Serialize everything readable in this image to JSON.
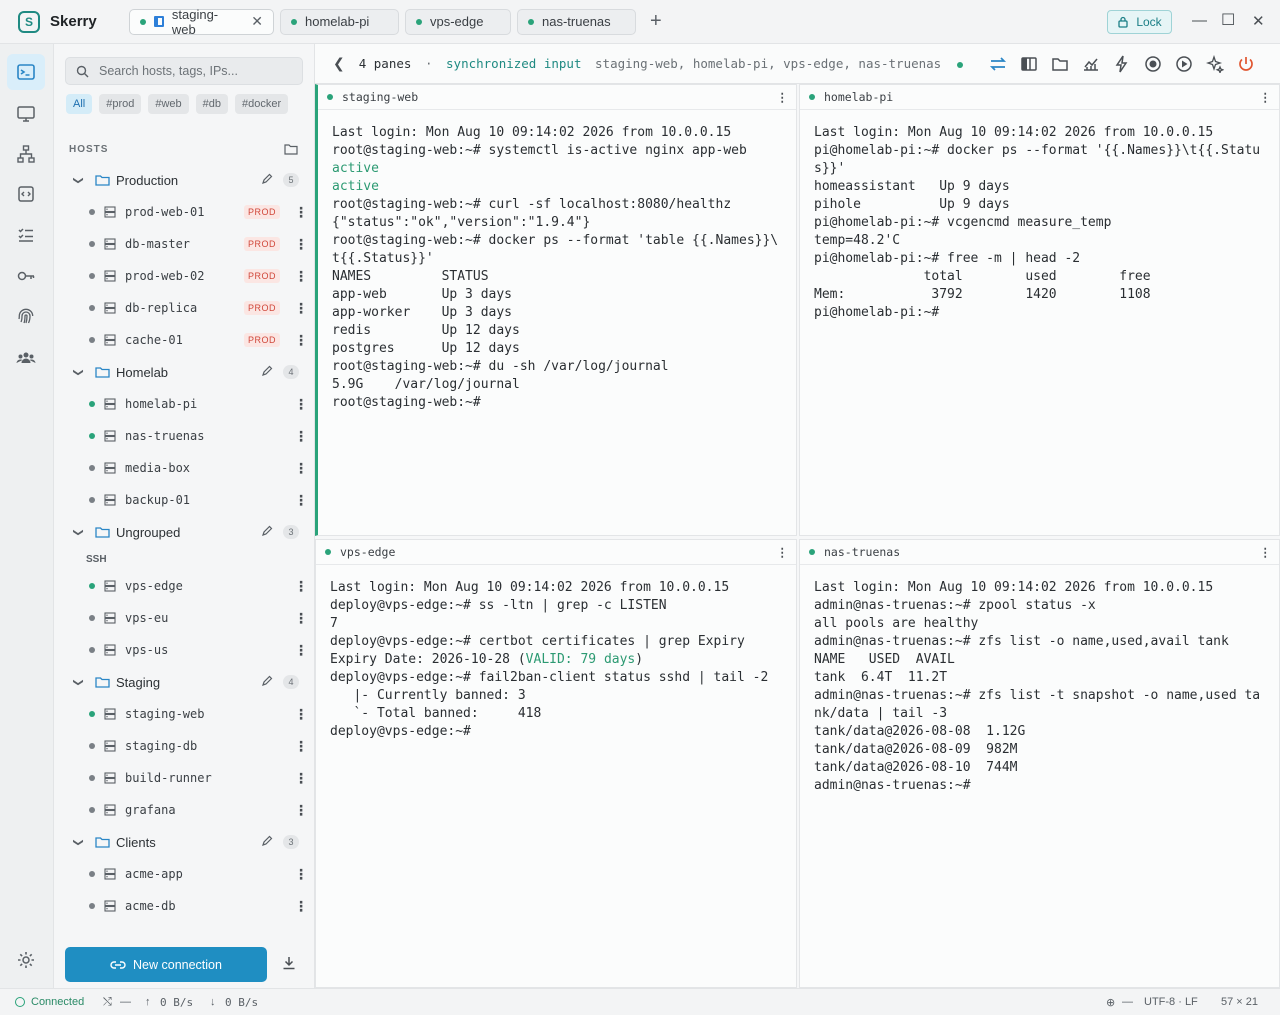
{
  "app": {
    "name": "Skerry"
  },
  "tabs": [
    {
      "label": "staging-web",
      "active": true
    },
    {
      "label": "homelab-pi",
      "active": false
    },
    {
      "label": "vps-edge",
      "active": false
    },
    {
      "label": "nas-truenas",
      "active": false
    }
  ],
  "titlebar": {
    "lock_label": "Lock",
    "minimize": "—",
    "maximize": "☐",
    "close": "✕",
    "add_tab": "+"
  },
  "sidebar": {
    "search_placeholder": "Search hosts, tags, IPs...",
    "tags": [
      "All",
      "#prod",
      "#web",
      "#db",
      "#docker"
    ],
    "hosts_label": "HOSTS",
    "groups": [
      {
        "name": "Production",
        "count": "5",
        "hosts": [
          {
            "name": "prod-web-01",
            "badge": "PROD",
            "online": false
          },
          {
            "name": "db-master",
            "badge": "PROD",
            "online": false
          },
          {
            "name": "prod-web-02",
            "badge": "PROD",
            "online": false
          },
          {
            "name": "db-replica",
            "badge": "PROD",
            "online": false
          },
          {
            "name": "cache-01",
            "badge": "PROD",
            "online": false
          }
        ]
      },
      {
        "name": "Homelab",
        "count": "4",
        "hosts": [
          {
            "name": "homelab-pi",
            "online": true
          },
          {
            "name": "nas-truenas",
            "online": true
          },
          {
            "name": "media-box",
            "online": false
          },
          {
            "name": "backup-01",
            "online": false
          }
        ]
      },
      {
        "name": "Ungrouped",
        "count": "3",
        "subhead": "SSH",
        "hosts": [
          {
            "name": "vps-edge",
            "online": true
          },
          {
            "name": "vps-eu",
            "online": false
          },
          {
            "name": "vps-us",
            "online": false
          }
        ]
      },
      {
        "name": "Staging",
        "count": "4",
        "hosts": [
          {
            "name": "staging-web",
            "online": true
          },
          {
            "name": "staging-db",
            "online": false
          },
          {
            "name": "build-runner",
            "online": false
          },
          {
            "name": "grafana",
            "online": false
          }
        ]
      },
      {
        "name": "Clients",
        "count": "3",
        "hosts": [
          {
            "name": "acme-app",
            "online": false
          },
          {
            "name": "acme-db",
            "online": false
          }
        ]
      }
    ],
    "new_connection": "New connection"
  },
  "toolbar": {
    "panes": "4 panes",
    "sep": "·",
    "sync_label": "synchronized input",
    "sync_hosts": "staging-web, homelab-pi, vps-edge, nas-truenas"
  },
  "panes": [
    {
      "title": "staging-web",
      "lines": [
        {
          "t": "Last login: Mon Aug 10 09:14:02 2026 from 10.0.0.15"
        },
        {
          "t": "root@staging-web:~# systemctl is-active nginx app-web"
        },
        {
          "t": "active",
          "c": "green"
        },
        {
          "t": "active",
          "c": "green"
        },
        {
          "t": "root@staging-web:~# curl -sf localhost:8080/healthz"
        },
        {
          "t": "{\"status\":\"ok\",\"version\":\"1.9.4\"}"
        },
        {
          "t": "root@staging-web:~# docker ps --format 'table {{.Names}}\\"
        },
        {
          "t": "t{{.Status}}'"
        },
        {
          "t": "NAMES         STATUS"
        },
        {
          "t": "app-web       Up 3 days"
        },
        {
          "t": "app-worker    Up 3 days"
        },
        {
          "t": "redis         Up 12 days"
        },
        {
          "t": "postgres      Up 12 days"
        },
        {
          "t": "root@staging-web:~# du -sh /var/log/journal"
        },
        {
          "t": "5.9G    /var/log/journal"
        },
        {
          "t": "root@staging-web:~#"
        }
      ]
    },
    {
      "title": "homelab-pi",
      "lines": [
        {
          "t": "Last login: Mon Aug 10 09:14:02 2026 from 10.0.0.15"
        },
        {
          "t": "pi@homelab-pi:~# docker ps --format '{{.Names}}\\t{{.Statu"
        },
        {
          "t": "s}}'"
        },
        {
          "t": "homeassistant   Up 9 days"
        },
        {
          "t": "pihole          Up 9 days"
        },
        {
          "t": "pi@homelab-pi:~# vcgencmd measure_temp"
        },
        {
          "t": "temp=48.2'C"
        },
        {
          "t": "pi@homelab-pi:~# free -m | head -2"
        },
        {
          "t": "              total        used        free"
        },
        {
          "t": "Mem:           3792        1420        1108"
        },
        {
          "t": "pi@homelab-pi:~#"
        }
      ]
    },
    {
      "title": "vps-edge",
      "lines": [
        {
          "t": "Last login: Mon Aug 10 09:14:02 2026 from 10.0.0.15"
        },
        {
          "t": "deploy@vps-edge:~# ss -ltn | grep -c LISTEN"
        },
        {
          "t": "7"
        },
        {
          "t": "deploy@vps-edge:~# certbot certificates | grep Expiry"
        },
        {
          "t": "Expiry Date: 2026-10-28 (",
          "g": "VALID: 79 days",
          "e": ")"
        },
        {
          "t": "deploy@vps-edge:~# fail2ban-client status sshd | tail -2"
        },
        {
          "t": "   |- Currently banned: 3"
        },
        {
          "t": "   `- Total banned:     418"
        },
        {
          "t": "deploy@vps-edge:~#"
        }
      ]
    },
    {
      "title": "nas-truenas",
      "lines": [
        {
          "t": "Last login: Mon Aug 10 09:14:02 2026 from 10.0.0.15"
        },
        {
          "t": "admin@nas-truenas:~# zpool status -x"
        },
        {
          "t": "all pools are healthy"
        },
        {
          "t": "admin@nas-truenas:~# zfs list -o name,used,avail tank"
        },
        {
          "t": "NAME   USED  AVAIL"
        },
        {
          "t": "tank  6.4T  11.2T"
        },
        {
          "t": "admin@nas-truenas:~# zfs list -t snapshot -o name,used ta"
        },
        {
          "t": "nk/data | tail -3"
        },
        {
          "t": "tank/data@2026-08-08  1.12G"
        },
        {
          "t": "tank/data@2026-08-09  982M"
        },
        {
          "t": "tank/data@2026-08-10  744M"
        },
        {
          "t": "admin@nas-truenas:~#"
        }
      ]
    }
  ],
  "statusbar": {
    "connected": "Connected",
    "ports": "—",
    "up": "0 B/s",
    "down": "0 B/s",
    "globe": "—",
    "encoding": "UTF-8 · LF",
    "size": "57 × 21"
  },
  "colors": {
    "accent": "#1f8ec2",
    "online": "#2aa37a",
    "prod": "#d0473a"
  }
}
